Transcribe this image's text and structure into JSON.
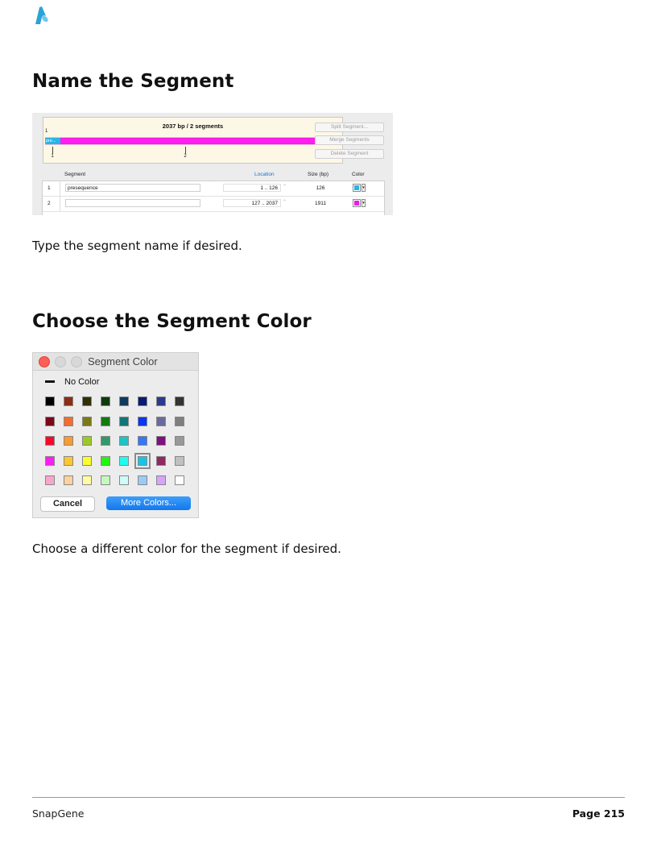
{
  "heading1": "Name the Segment",
  "caption1": "Type the segment name if desired.",
  "heading2": "Choose the Segment Color",
  "caption2": "Choose a different color for the segment if desired.",
  "segment_editor": {
    "summary": "2037 bp  /  2 segments",
    "start": "1",
    "end": "2037",
    "first_segment_label": "pre...",
    "marker_1": "1",
    "marker_2": "2",
    "buttons": {
      "split": "Split Segment...",
      "merge": "Merge Segments",
      "delete": "Delete Segment"
    },
    "columns": {
      "segment": "Segment",
      "location": "Location",
      "size": "Size (bp)",
      "color": "Color"
    },
    "rows": [
      {
        "num": "1",
        "name": "presequence",
        "location": "1  ..  126",
        "size": "126",
        "color": "#27b5e5"
      },
      {
        "num": "2",
        "name": "",
        "location": "127  ..  2037",
        "size": "1911",
        "color": "#e61ee6"
      }
    ],
    "accent_color": "#1e73c8",
    "arrow_color": "#ff1ff0"
  },
  "color_picker": {
    "title": "Segment Color",
    "no_color_label": "No Color",
    "cancel_label": "Cancel",
    "more_label": "More Colors...",
    "selected": "#17c4e8",
    "swatches": [
      [
        "#000000",
        "#8b2e14",
        "#2f3005",
        "#0e3a0d",
        "#103a5c",
        "#0b1a73",
        "#2b3a8f",
        "#333333"
      ],
      [
        "#7e0717",
        "#f66b2e",
        "#7a7a16",
        "#127a12",
        "#137676",
        "#0b35f0",
        "#6a6aa0",
        "#7f7f7f"
      ],
      [
        "#f5092b",
        "#f99c2f",
        "#9dc925",
        "#33996c",
        "#1cc4c4",
        "#3577f5",
        "#800f80",
        "#999999"
      ],
      [
        "#fa1ef2",
        "#fcc72d",
        "#fafc2e",
        "#22f50f",
        "#1efcf2",
        "#17c4e8",
        "#8e2a5e",
        "#c0c0c0"
      ],
      [
        "#f7a6cb",
        "#fad2a0",
        "#fdfba5",
        "#c6f7c1",
        "#cdfcf9",
        "#9ccaf5",
        "#d5a6f7",
        "#ffffff"
      ]
    ]
  },
  "footer": {
    "left": "SnapGene",
    "right": "Page 215"
  }
}
